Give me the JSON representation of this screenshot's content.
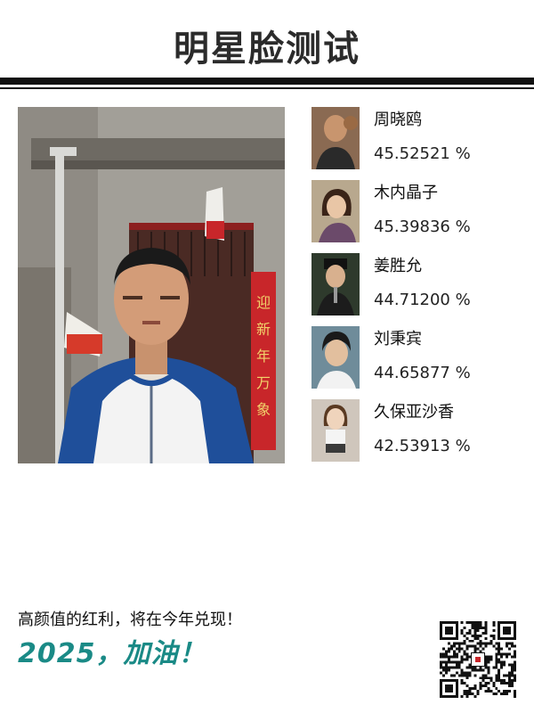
{
  "header": {
    "title": "明星脸测试"
  },
  "photo": {
    "banner_text": "迎新年万象"
  },
  "matches": [
    {
      "name": "周晓鸥",
      "score": "45.52521 %"
    },
    {
      "name": "木内晶子",
      "score": "45.39836 %"
    },
    {
      "name": "姜胜允",
      "score": "44.71200 %"
    },
    {
      "name": "刘秉宾",
      "score": "44.65877 %"
    },
    {
      "name": "久保亚沙香",
      "score": "42.53913 %"
    }
  ],
  "footer": {
    "slogan_line1": "高颜值的红利，将在今年兑现！",
    "slogan_line2": "2025，加油！"
  },
  "colors": {
    "accent": "#1a8a86",
    "rule": "#111111"
  }
}
